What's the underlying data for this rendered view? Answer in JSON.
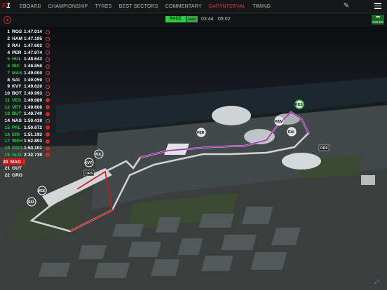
{
  "nav": {
    "items": [
      {
        "label": "EBOARD",
        "active": false
      },
      {
        "label": "CHAMPIONSHIP",
        "active": false
      },
      {
        "label": "TYRES",
        "active": false
      },
      {
        "label": "BEST SECTORS",
        "active": false
      },
      {
        "label": "COMMENTARY",
        "active": false
      },
      {
        "label": "GAP/INTERVAL",
        "active": true
      },
      {
        "label": "TIMING",
        "active": false
      }
    ]
  },
  "session": {
    "label": "RACE",
    "elapsed": "03:44",
    "remaining": "05:02"
  },
  "colors": {
    "accent": "#e23b3b",
    "green": "#2ecc40",
    "background": "#0b0e10"
  },
  "leaderboard": [
    {
      "pos": "1",
      "driver": "ROS",
      "time": "1:47.014",
      "style": "w",
      "pit": "ring"
    },
    {
      "pos": "2",
      "driver": "HAM",
      "time": "1:47.195",
      "style": "w",
      "pit": "ring"
    },
    {
      "pos": "3",
      "driver": "RAI",
      "time": "1:47.602",
      "style": "w",
      "pit": "ring"
    },
    {
      "pos": "4",
      "driver": "PER",
      "time": "1:47.974",
      "style": "w",
      "pit": "ring"
    },
    {
      "pos": "5",
      "driver": "HUL",
      "time": "1:48.643",
      "style": "g",
      "pit": "ring"
    },
    {
      "pos": "6",
      "driver": "RIC",
      "time": "1:48.856",
      "style": "g",
      "pit": "ring"
    },
    {
      "pos": "7",
      "driver": "MAS",
      "time": "1:49.000",
      "style": "g",
      "pit": "ring"
    },
    {
      "pos": "8",
      "driver": "SAI",
      "time": "1:49.059",
      "style": "w",
      "pit": "ring"
    },
    {
      "pos": "9",
      "driver": "KVY",
      "time": "1:49.620",
      "style": "w",
      "pit": "ring"
    },
    {
      "pos": "10",
      "driver": "BOT",
      "time": "1:49.993",
      "style": "w",
      "pit": "ring"
    },
    {
      "pos": "11",
      "driver": "VES",
      "time": "1:49.689",
      "style": "g",
      "pit": "red"
    },
    {
      "pos": "12",
      "driver": "VET",
      "time": "1:49.608",
      "style": "g",
      "pit": "red"
    },
    {
      "pos": "13",
      "driver": "BUT",
      "time": "1:49.740",
      "style": "g",
      "pit": "red"
    },
    {
      "pos": "14",
      "driver": "NAS",
      "time": "1:50.418",
      "style": "w",
      "pit": "ring"
    },
    {
      "pos": "15",
      "driver": "PAL",
      "time": "1:50.672",
      "style": "g",
      "pit": "red"
    },
    {
      "pos": "16",
      "driver": "ERI",
      "time": "1:51.192",
      "style": "g",
      "pit": "red"
    },
    {
      "pos": "17",
      "driver": "WEH",
      "time": "1:52.893",
      "style": "g",
      "pit": "red"
    },
    {
      "pos": "18",
      "driver": "OGO",
      "time": "1:53.101",
      "style": "g",
      "pit": "red"
    },
    {
      "pos": "19",
      "driver": "ALO",
      "time": "2:32.739",
      "style": "g",
      "pit": "red"
    },
    {
      "pos": "20",
      "driver": "MAG",
      "time": "",
      "style": "sel",
      "pit": "red"
    },
    {
      "pos": "21",
      "driver": "GUT",
      "time": "",
      "style": "w",
      "pit": "none"
    },
    {
      "pos": "22",
      "driver": "GRO",
      "time": "",
      "style": "w",
      "pit": "none"
    }
  ],
  "map_markers": [
    {
      "label": "ROS"
    },
    {
      "label": "HAM"
    },
    {
      "label": "RAI"
    },
    {
      "label": "PER"
    },
    {
      "label": "HUL"
    },
    {
      "label": "SAI"
    },
    {
      "label": "KVY"
    },
    {
      "label": "VES"
    },
    {
      "label": "DRS"
    },
    {
      "label": "DRS"
    }
  ],
  "icons": {
    "logo": "f1-logo",
    "record": "record-icon",
    "settings": "wrench-icon",
    "menu": "hamburger-menu-icon",
    "sponsor": "rolex-icon",
    "expand": "expand-icon"
  },
  "sponsor": {
    "label": "ROLEX"
  }
}
